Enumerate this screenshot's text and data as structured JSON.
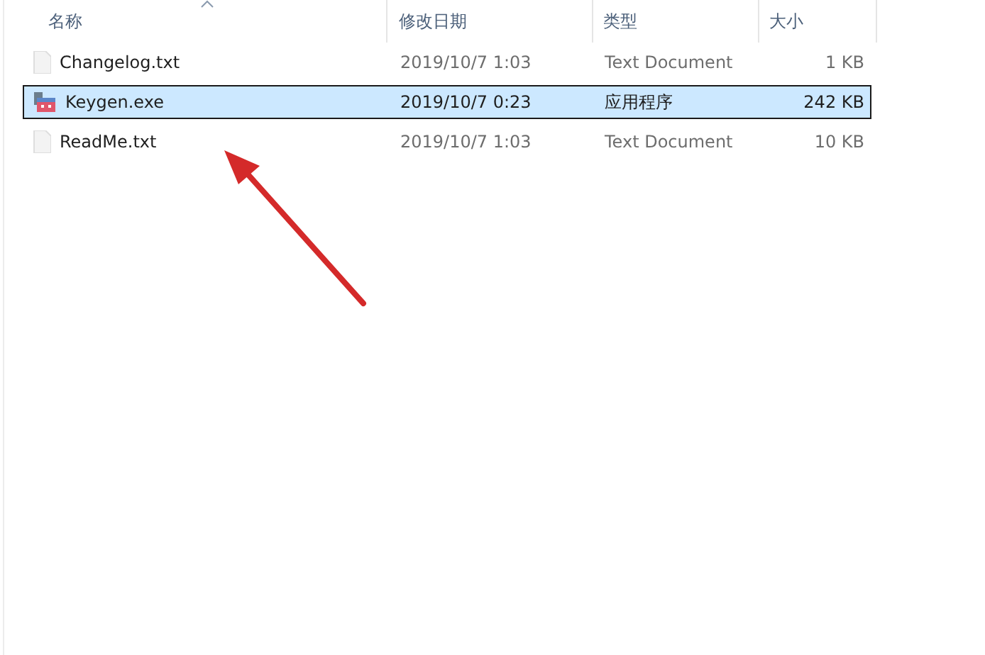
{
  "columns": [
    {
      "label": "名称",
      "sorted": true
    },
    {
      "label": "修改日期",
      "sorted": false
    },
    {
      "label": "类型",
      "sorted": false
    },
    {
      "label": "大小",
      "sorted": false
    }
  ],
  "files": [
    {
      "name": "Changelog.txt",
      "kind": "text",
      "modified": "2019/10/7 1:03",
      "type": "Text Document",
      "size": "1 KB",
      "selected": false
    },
    {
      "name": "Keygen.exe",
      "kind": "app",
      "modified": "2019/10/7 0:23",
      "type": "应用程序",
      "size": "242 KB",
      "selected": true
    },
    {
      "name": "ReadMe.txt",
      "kind": "text",
      "modified": "2019/10/7 1:03",
      "type": "Text Document",
      "size": "10 KB",
      "selected": false
    }
  ]
}
